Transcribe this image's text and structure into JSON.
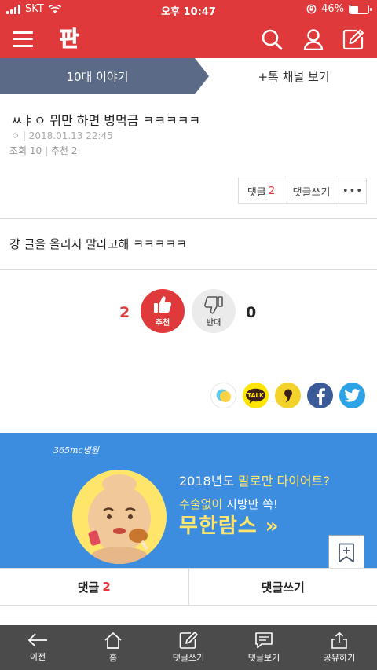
{
  "status_bar": {
    "carrier": "SKT",
    "time": "오후 10:47",
    "battery": "46%",
    "battery_level": 0.46
  },
  "header": {
    "logo_text": "판"
  },
  "tabs": {
    "active": "10대 이야기",
    "other": "+톡 채널 보기"
  },
  "post": {
    "title": "ㅆㅑㅇ 뭐만 하면 병먹금 ㅋㅋㅋㅋㅋ",
    "meta": "ㅇ  | 2018.01.13 22:45",
    "stats": "조회 10 | 추천 2",
    "comments_label": "댓글",
    "comments_count": "2",
    "write_comment_label": "댓글쓰기",
    "more_label": "•••",
    "body": "걍 글을 올리지 말라고해 ㅋㅋㅋㅋㅋ"
  },
  "votes": {
    "up_count": "2",
    "up_label": "추천",
    "down_count": "0",
    "down_label": "반대"
  },
  "share": {
    "kakaotalk_label": "TALK"
  },
  "ad": {
    "hospital": "365mc병원",
    "line1_a": "2018년도 ",
    "line1_b": "말로만 다이어트?",
    "line2_a": "수술없이 ",
    "line2_b": "지방만 쏙!",
    "line3": "무한람스 »"
  },
  "bottom_comments": {
    "comments_label": "댓글",
    "comments_count": "2",
    "write_label": "댓글쓰기"
  },
  "toolbar": {
    "back": "이전",
    "home": "홈",
    "write": "댓글쓰기",
    "view": "댓글보기",
    "share": "공유하기"
  },
  "colors": {
    "brand_red": "#e0393b",
    "tab_slate": "#5a6a87",
    "ad_blue": "#3c8de0",
    "toolbar_gray": "#4b4b4b"
  }
}
